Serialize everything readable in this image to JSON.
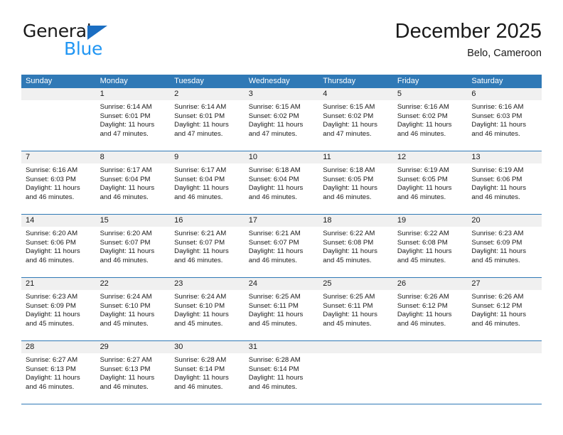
{
  "logo": {
    "primary_text": "General",
    "secondary_text": "Blue",
    "primary_color": "#1a1a1a",
    "secondary_color": "#2196f3",
    "triangle_color": "#1b6ec2"
  },
  "header": {
    "title": "December 2025",
    "subtitle": "Belo, Cameroon"
  },
  "theme": {
    "header_row_bg": "#3079b6",
    "header_row_text": "#ffffff",
    "daynum_row_bg": "#f0f0f0",
    "grid_line": "#3079b6",
    "cell_bg": "#ffffff",
    "text": "#1a1a1a"
  },
  "weekdays": [
    "Sunday",
    "Monday",
    "Tuesday",
    "Wednesday",
    "Thursday",
    "Friday",
    "Saturday"
  ],
  "weeks": [
    {
      "days": [
        {
          "num": "",
          "lines": [
            "",
            "",
            "",
            ""
          ],
          "blank": true
        },
        {
          "num": "1",
          "lines": [
            "Sunrise: 6:14 AM",
            "Sunset: 6:01 PM",
            "Daylight: 11 hours",
            "and 47 minutes."
          ],
          "blank": false
        },
        {
          "num": "2",
          "lines": [
            "Sunrise: 6:14 AM",
            "Sunset: 6:01 PM",
            "Daylight: 11 hours",
            "and 47 minutes."
          ],
          "blank": false
        },
        {
          "num": "3",
          "lines": [
            "Sunrise: 6:15 AM",
            "Sunset: 6:02 PM",
            "Daylight: 11 hours",
            "and 47 minutes."
          ],
          "blank": false
        },
        {
          "num": "4",
          "lines": [
            "Sunrise: 6:15 AM",
            "Sunset: 6:02 PM",
            "Daylight: 11 hours",
            "and 47 minutes."
          ],
          "blank": false
        },
        {
          "num": "5",
          "lines": [
            "Sunrise: 6:16 AM",
            "Sunset: 6:02 PM",
            "Daylight: 11 hours",
            "and 46 minutes."
          ],
          "blank": false
        },
        {
          "num": "6",
          "lines": [
            "Sunrise: 6:16 AM",
            "Sunset: 6:03 PM",
            "Daylight: 11 hours",
            "and 46 minutes."
          ],
          "blank": false
        }
      ]
    },
    {
      "days": [
        {
          "num": "7",
          "lines": [
            "Sunrise: 6:16 AM",
            "Sunset: 6:03 PM",
            "Daylight: 11 hours",
            "and 46 minutes."
          ],
          "blank": false
        },
        {
          "num": "8",
          "lines": [
            "Sunrise: 6:17 AM",
            "Sunset: 6:04 PM",
            "Daylight: 11 hours",
            "and 46 minutes."
          ],
          "blank": false
        },
        {
          "num": "9",
          "lines": [
            "Sunrise: 6:17 AM",
            "Sunset: 6:04 PM",
            "Daylight: 11 hours",
            "and 46 minutes."
          ],
          "blank": false
        },
        {
          "num": "10",
          "lines": [
            "Sunrise: 6:18 AM",
            "Sunset: 6:04 PM",
            "Daylight: 11 hours",
            "and 46 minutes."
          ],
          "blank": false
        },
        {
          "num": "11",
          "lines": [
            "Sunrise: 6:18 AM",
            "Sunset: 6:05 PM",
            "Daylight: 11 hours",
            "and 46 minutes."
          ],
          "blank": false
        },
        {
          "num": "12",
          "lines": [
            "Sunrise: 6:19 AM",
            "Sunset: 6:05 PM",
            "Daylight: 11 hours",
            "and 46 minutes."
          ],
          "blank": false
        },
        {
          "num": "13",
          "lines": [
            "Sunrise: 6:19 AM",
            "Sunset: 6:06 PM",
            "Daylight: 11 hours",
            "and 46 minutes."
          ],
          "blank": false
        }
      ]
    },
    {
      "days": [
        {
          "num": "14",
          "lines": [
            "Sunrise: 6:20 AM",
            "Sunset: 6:06 PM",
            "Daylight: 11 hours",
            "and 46 minutes."
          ],
          "blank": false
        },
        {
          "num": "15",
          "lines": [
            "Sunrise: 6:20 AM",
            "Sunset: 6:07 PM",
            "Daylight: 11 hours",
            "and 46 minutes."
          ],
          "blank": false
        },
        {
          "num": "16",
          "lines": [
            "Sunrise: 6:21 AM",
            "Sunset: 6:07 PM",
            "Daylight: 11 hours",
            "and 46 minutes."
          ],
          "blank": false
        },
        {
          "num": "17",
          "lines": [
            "Sunrise: 6:21 AM",
            "Sunset: 6:07 PM",
            "Daylight: 11 hours",
            "and 46 minutes."
          ],
          "blank": false
        },
        {
          "num": "18",
          "lines": [
            "Sunrise: 6:22 AM",
            "Sunset: 6:08 PM",
            "Daylight: 11 hours",
            "and 45 minutes."
          ],
          "blank": false
        },
        {
          "num": "19",
          "lines": [
            "Sunrise: 6:22 AM",
            "Sunset: 6:08 PM",
            "Daylight: 11 hours",
            "and 45 minutes."
          ],
          "blank": false
        },
        {
          "num": "20",
          "lines": [
            "Sunrise: 6:23 AM",
            "Sunset: 6:09 PM",
            "Daylight: 11 hours",
            "and 45 minutes."
          ],
          "blank": false
        }
      ]
    },
    {
      "days": [
        {
          "num": "21",
          "lines": [
            "Sunrise: 6:23 AM",
            "Sunset: 6:09 PM",
            "Daylight: 11 hours",
            "and 45 minutes."
          ],
          "blank": false
        },
        {
          "num": "22",
          "lines": [
            "Sunrise: 6:24 AM",
            "Sunset: 6:10 PM",
            "Daylight: 11 hours",
            "and 45 minutes."
          ],
          "blank": false
        },
        {
          "num": "23",
          "lines": [
            "Sunrise: 6:24 AM",
            "Sunset: 6:10 PM",
            "Daylight: 11 hours",
            "and 45 minutes."
          ],
          "blank": false
        },
        {
          "num": "24",
          "lines": [
            "Sunrise: 6:25 AM",
            "Sunset: 6:11 PM",
            "Daylight: 11 hours",
            "and 45 minutes."
          ],
          "blank": false
        },
        {
          "num": "25",
          "lines": [
            "Sunrise: 6:25 AM",
            "Sunset: 6:11 PM",
            "Daylight: 11 hours",
            "and 45 minutes."
          ],
          "blank": false
        },
        {
          "num": "26",
          "lines": [
            "Sunrise: 6:26 AM",
            "Sunset: 6:12 PM",
            "Daylight: 11 hours",
            "and 46 minutes."
          ],
          "blank": false
        },
        {
          "num": "27",
          "lines": [
            "Sunrise: 6:26 AM",
            "Sunset: 6:12 PM",
            "Daylight: 11 hours",
            "and 46 minutes."
          ],
          "blank": false
        }
      ]
    },
    {
      "days": [
        {
          "num": "28",
          "lines": [
            "Sunrise: 6:27 AM",
            "Sunset: 6:13 PM",
            "Daylight: 11 hours",
            "and 46 minutes."
          ],
          "blank": false
        },
        {
          "num": "29",
          "lines": [
            "Sunrise: 6:27 AM",
            "Sunset: 6:13 PM",
            "Daylight: 11 hours",
            "and 46 minutes."
          ],
          "blank": false
        },
        {
          "num": "30",
          "lines": [
            "Sunrise: 6:28 AM",
            "Sunset: 6:14 PM",
            "Daylight: 11 hours",
            "and 46 minutes."
          ],
          "blank": false
        },
        {
          "num": "31",
          "lines": [
            "Sunrise: 6:28 AM",
            "Sunset: 6:14 PM",
            "Daylight: 11 hours",
            "and 46 minutes."
          ],
          "blank": false
        },
        {
          "num": "",
          "lines": [
            "",
            "",
            "",
            ""
          ],
          "blank": true
        },
        {
          "num": "",
          "lines": [
            "",
            "",
            "",
            ""
          ],
          "blank": true
        },
        {
          "num": "",
          "lines": [
            "",
            "",
            "",
            ""
          ],
          "blank": true
        }
      ]
    }
  ]
}
